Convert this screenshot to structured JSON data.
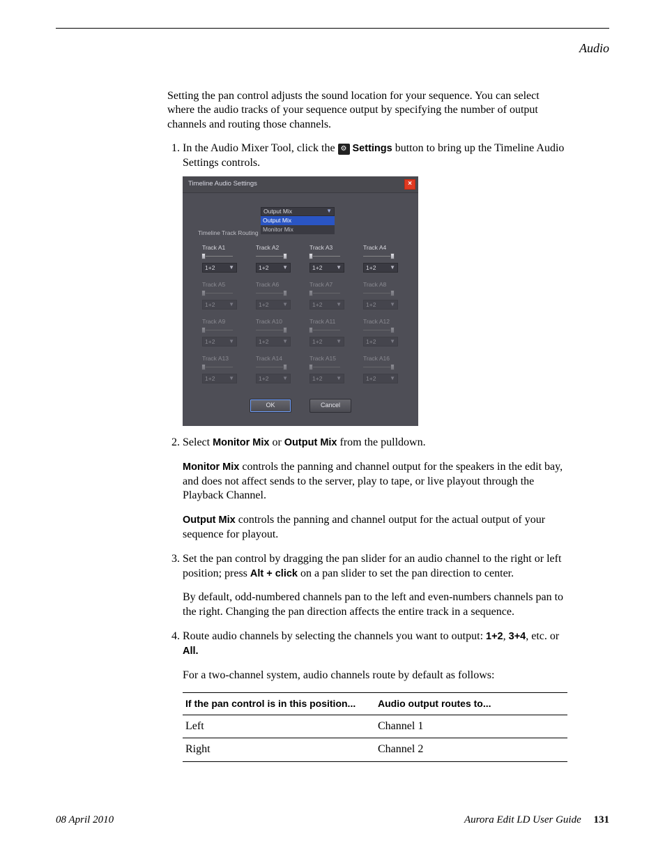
{
  "header": {
    "section": "Audio"
  },
  "intro": "Setting the pan control adjusts the sound location for your sequence. You can select where the audio tracks of your sequence output by specifying the number of output channels and routing those channels.",
  "step1": {
    "before_icon": "In the Audio Mixer Tool, click the ",
    "settings_word": "Settings",
    "after_icon": " button to bring up the Timeline Audio Settings controls."
  },
  "screenshot": {
    "title": "Timeline Audio Settings",
    "mix_label": "Output Mix",
    "options": [
      "Output Mix",
      "Monitor Mix"
    ],
    "section_label": "Timeline Track Routing",
    "cell_value": "1+2",
    "tracks": [
      {
        "label": "Track A1",
        "pan": "left",
        "active": true
      },
      {
        "label": "Track A2",
        "pan": "right",
        "active": true
      },
      {
        "label": "Track A3",
        "pan": "left",
        "active": true
      },
      {
        "label": "Track A4",
        "pan": "right",
        "active": true
      },
      {
        "label": "Track A5",
        "pan": "left",
        "active": false
      },
      {
        "label": "Track A6",
        "pan": "right",
        "active": false
      },
      {
        "label": "Track A7",
        "pan": "left",
        "active": false
      },
      {
        "label": "Track A8",
        "pan": "right",
        "active": false
      },
      {
        "label": "Track A9",
        "pan": "left",
        "active": false
      },
      {
        "label": "Track A10",
        "pan": "right",
        "active": false
      },
      {
        "label": "Track A11",
        "pan": "left",
        "active": false
      },
      {
        "label": "Track A12",
        "pan": "right",
        "active": false
      },
      {
        "label": "Track A13",
        "pan": "left",
        "active": false
      },
      {
        "label": "Track A14",
        "pan": "right",
        "active": false
      },
      {
        "label": "Track A15",
        "pan": "left",
        "active": false
      },
      {
        "label": "Track A16",
        "pan": "right",
        "active": false
      }
    ],
    "buttons": {
      "ok": "OK",
      "cancel": "Cancel"
    }
  },
  "step2": {
    "text_pre": "Select ",
    "mm": "Monitor Mix",
    "or": " or ",
    "om": "Output Mix",
    "text_post": " from the pulldown.",
    "mm_desc_bold": "Monitor Mix",
    "mm_desc": " controls the panning and channel output for the speakers in the edit bay, and does not affect sends to the server, play to tape, or live playout through the Playback Channel.",
    "om_desc_bold": "Output Mix",
    "om_desc": " controls the panning and channel output for the actual output of your sequence for playout."
  },
  "step3": {
    "pre": "Set the pan control by dragging the pan slider for an audio channel to the right or left position; press ",
    "kbd": "Alt + click",
    "post": " on a pan slider to set the pan direction to center.",
    "para2": "By default, odd-numbered channels pan to the left and even-numbers channels pan to the right. Changing the pan direction affects the entire track in a sequence."
  },
  "step4": {
    "pre": "Route audio channels by selecting the channels you want to output: ",
    "v1": "1+2",
    "sep1": ", ",
    "v2": "3+4",
    "sep2": ", etc. or ",
    "v3": "All.",
    "intro": "For a two-channel system, audio channels route by default as follows:"
  },
  "table": {
    "headers": [
      "If the pan control is in this position...",
      "Audio output routes to..."
    ],
    "rows": [
      [
        "Left",
        "Channel 1"
      ],
      [
        "Right",
        "Channel 2"
      ]
    ]
  },
  "footer": {
    "date": "08 April 2010",
    "doc": "Aurora Edit LD User Guide",
    "page": "131"
  }
}
